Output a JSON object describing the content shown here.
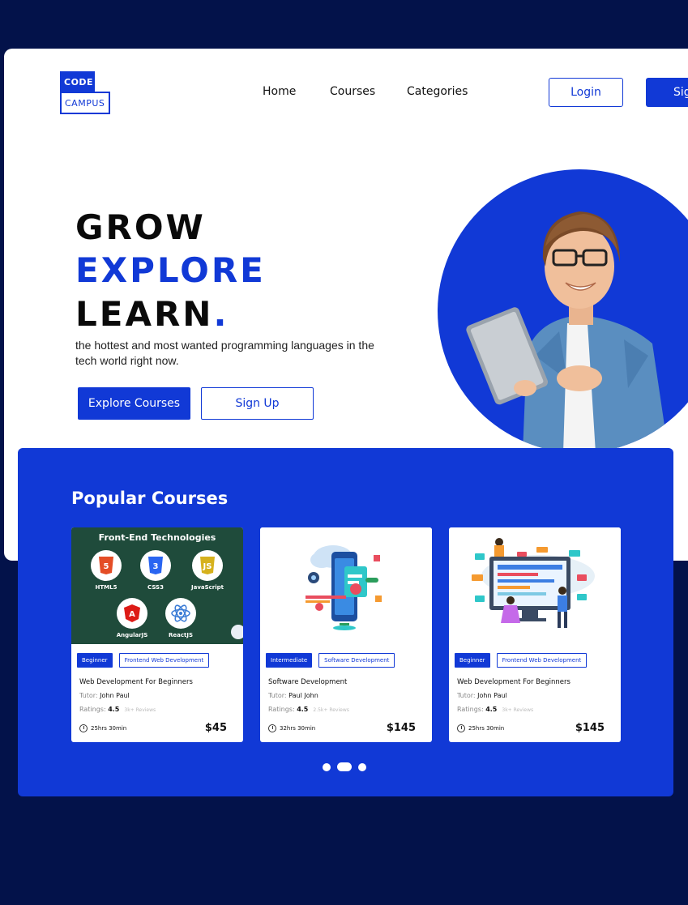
{
  "logo": {
    "top": "CODE",
    "bottom": "CAMPUS"
  },
  "nav": {
    "home": "Home",
    "courses": "Courses",
    "categories": "Categories"
  },
  "header": {
    "login": "Login",
    "signup": "Sig"
  },
  "hero": {
    "line1": "GROW",
    "line2": "EXPLORE",
    "line3": "LEARN",
    "line3_dot": ".",
    "subtitle": "the hottest and most wanted programming languages in the tech world right now.",
    "explore_button": "Explore Courses",
    "signup_button": "Sign Up"
  },
  "popular": {
    "title": "Popular Courses",
    "cards": [
      {
        "image_title": "Front-End Technologies",
        "techs": [
          "HTML5",
          "CSS3",
          "JavaScript",
          "AngularJS",
          "ReactJS"
        ],
        "level": "Beginner",
        "category": "Frontend Web Development",
        "title": "Web Development For Beginners",
        "tutor_label": "Tutor:",
        "tutor": "John Paul",
        "ratings_label": "Ratings:",
        "rating": "4.5",
        "reviews": "3k+ Reviews",
        "duration": "25hrs 30min",
        "price": "$45"
      },
      {
        "level": "Intermediate",
        "category": "Software Development",
        "title": "Software Development",
        "tutor_label": "Tutor:",
        "tutor": "Paul John",
        "ratings_label": "Ratings:",
        "rating": "4.5",
        "reviews": "2.5k+ Reviews",
        "duration": "32hrs 30min",
        "price": "$145"
      },
      {
        "level": "Beginner",
        "category": "Frontend Web Development",
        "title": "Web Development For Beginners",
        "tutor_label": "Tutor:",
        "tutor": "John Paul",
        "ratings_label": "Ratings:",
        "rating": "4.5",
        "reviews": "3k+ Reviews",
        "duration": "25hrs 30min",
        "price": "$145"
      }
    ]
  },
  "colors": {
    "brand_blue": "#1139d6",
    "navy_bg": "#03124a",
    "card_dark": "#1f4b3b"
  }
}
